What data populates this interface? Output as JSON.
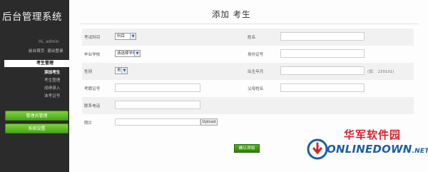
{
  "app": {
    "title": "后台管理系统"
  },
  "sidebar": {
    "welcome": "Hi, admin",
    "user_links": [
      "前台首页",
      "退出登录"
    ],
    "active_section": "考生管理",
    "subnav": [
      "添加考生",
      "考生管理",
      "成绩录入",
      "准考证号"
    ],
    "buttons": [
      "管理员管理",
      "系统设置"
    ]
  },
  "page": {
    "title": "添加 考生",
    "submit_label": "确认添加"
  },
  "form": {
    "rows": [
      {
        "left_label": "考试科目",
        "left_select": "科目",
        "right_label": "姓名"
      },
      {
        "left_label": "毕业学校",
        "left_select": "请选择学校",
        "right_label": "身份证号"
      },
      {
        "left_label": "性别",
        "left_select": "男",
        "right_label": "出生年月",
        "right_hint": "(如：  230101)"
      },
      {
        "left_label": "考籍证号",
        "right_label": "父母姓名"
      },
      {
        "left_label": "联系电话"
      },
      {
        "left_label": "照片",
        "file_button": "Upload"
      }
    ]
  },
  "watermark": {
    "cn": "华军软件园",
    "en": "ONLINEDOWN",
    "tld": ".NET"
  },
  "colors": {
    "sidebar_bg": "#2b2b2b",
    "green": "#5cb51f",
    "watermark_red": "#d6222a",
    "watermark_blue": "#1b5faa"
  }
}
